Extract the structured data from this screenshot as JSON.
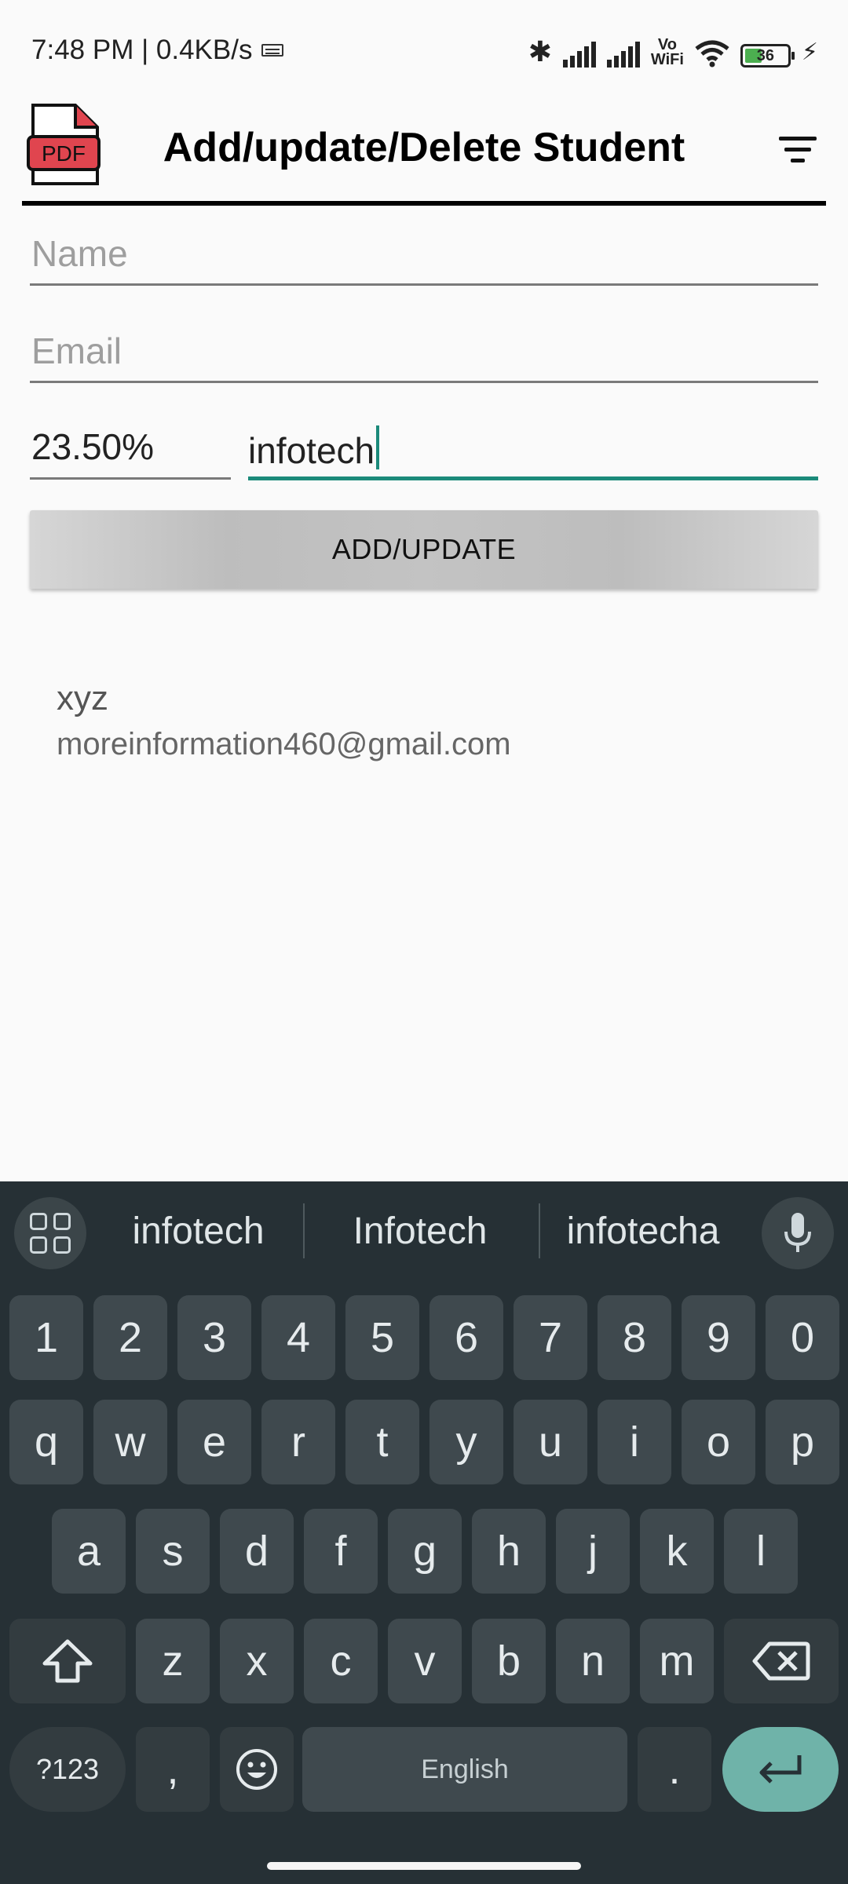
{
  "status_bar": {
    "left_text": "7:48 PM | 0.4KB/s",
    "vo_wifi": "Vo\nWiFi",
    "battery_level": "36",
    "icons": [
      "keyboard-icon",
      "bluetooth-icon",
      "signal-icon",
      "signal-icon",
      "vowifi-icon",
      "wifi-icon",
      "battery-icon",
      "charging-icon"
    ]
  },
  "app_bar": {
    "logo_text": "PDF",
    "title": "Add/update/Delete Student",
    "filter_icon": "filter-icon"
  },
  "form": {
    "name_placeholder": "Name",
    "email_placeholder": "Email",
    "percent_value": "23.50%",
    "company_value": "infotech",
    "submit_label": "ADD/UPDATE"
  },
  "students": [
    {
      "name": "xyz",
      "email": "moreinformation460@gmail.com"
    }
  ],
  "keyboard": {
    "suggestions": [
      "infotech",
      "Infotech",
      "infotecha"
    ],
    "row_numbers": [
      "1",
      "2",
      "3",
      "4",
      "5",
      "6",
      "7",
      "8",
      "9",
      "0"
    ],
    "row_top": [
      "q",
      "w",
      "e",
      "r",
      "t",
      "y",
      "u",
      "i",
      "o",
      "p"
    ],
    "row_middle": [
      "a",
      "s",
      "d",
      "f",
      "g",
      "h",
      "j",
      "k",
      "l"
    ],
    "row_bottom": [
      "z",
      "x",
      "c",
      "v",
      "b",
      "n",
      "m"
    ],
    "symbols_label": "?123",
    "comma_label": ",",
    "space_label": "English",
    "period_label": "."
  },
  "colors": {
    "accent": "#1b8a7a",
    "keyboard_bg": "#263035",
    "key_bg": "#3f494e",
    "enter_bg": "#6fb3a9",
    "logo_red": "#e0454f"
  }
}
